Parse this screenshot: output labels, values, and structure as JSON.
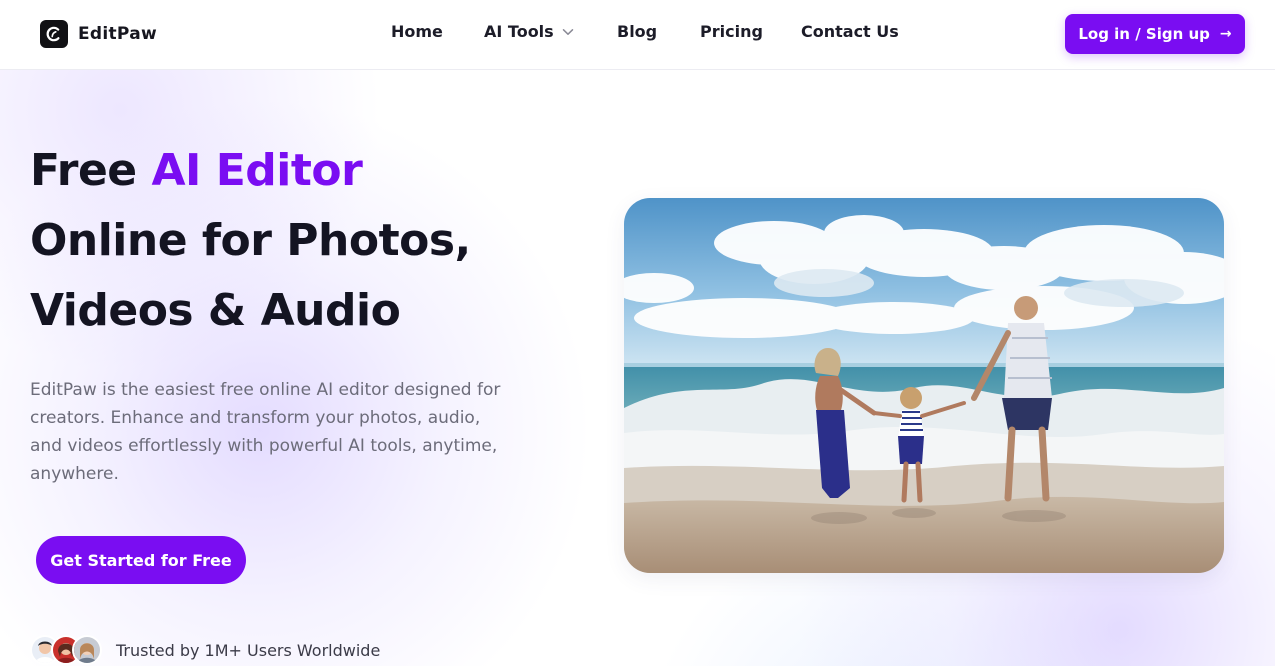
{
  "brand": {
    "name": "EditPaw",
    "logo_icon": "editpaw-logo-icon"
  },
  "nav": {
    "items": [
      {
        "label": "Home"
      },
      {
        "label": "AI Tools",
        "has_dropdown": true
      },
      {
        "label": "Blog"
      },
      {
        "label": "Pricing"
      },
      {
        "label": "Contact Us"
      }
    ],
    "login_label": "Log in / Sign up",
    "login_arrow": "→"
  },
  "hero": {
    "title_prefix": "Free ",
    "title_accent": "AI Editor",
    "title_line2": "Online for Photos,",
    "title_line3": "Videos & Audio",
    "description": "EditPaw is the easiest free online AI editor designed for creators. Enhance and transform your photos, audio, and videos effortlessly with powerful AI tools, anytime, anywhere.",
    "cta_label": "Get Started for Free",
    "trust_text": "Trusted by 1M+ Users Worldwide"
  },
  "colors": {
    "accent": "#7a0df2",
    "heading": "#141422",
    "body_text": "#6c6c7a"
  }
}
